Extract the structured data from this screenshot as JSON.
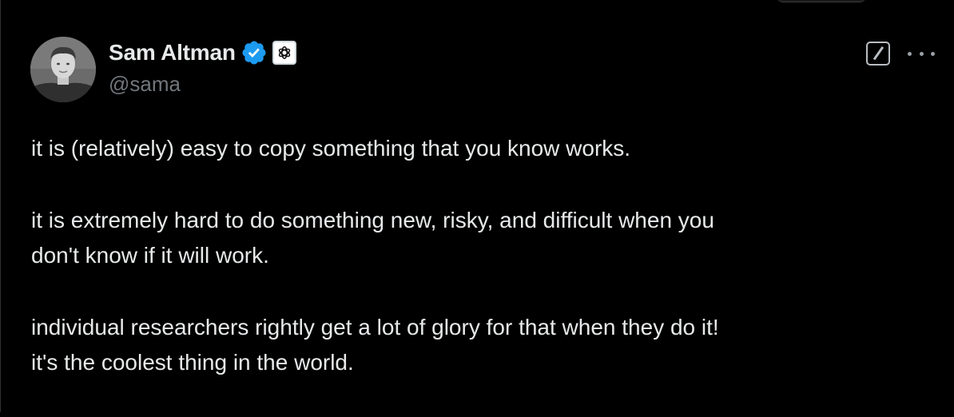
{
  "author": {
    "display_name": "Sam Altman",
    "handle": "@sama",
    "verified_color": "#1d9bf0"
  },
  "icons": {
    "verified": "verified-check-badge-icon",
    "affiliate": "openai-logo-icon",
    "grok": "grok-icon",
    "more": "more-options-icon",
    "avatar": "profile-photo"
  },
  "tweet": {
    "paragraphs": [
      {
        "lines": [
          "it is (relatively) easy to copy something that you know works."
        ]
      },
      {
        "lines": [
          "it is extremely hard to do something new, risky, and difficult when you",
          "don't know if it will work."
        ]
      },
      {
        "lines": [
          "individual researchers rightly get a lot of glory for that when they do it!",
          "it's the coolest thing in the world."
        ]
      }
    ]
  },
  "colors": {
    "background": "#000000",
    "text_primary": "#e7e9ea",
    "text_secondary": "#71767b",
    "accent": "#1d9bf0"
  }
}
